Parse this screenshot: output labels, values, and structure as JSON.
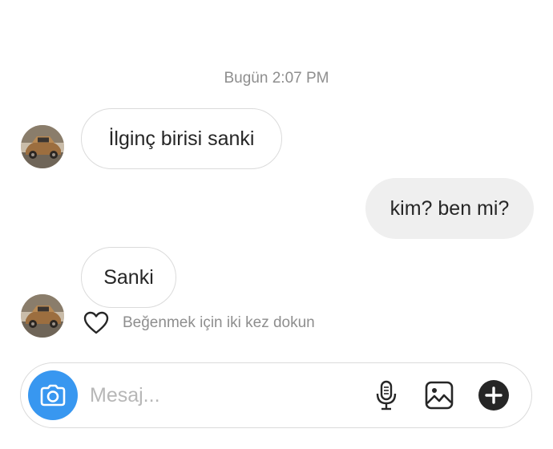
{
  "thread": {
    "timestamp": "Bugün 2:07 PM",
    "messages": [
      {
        "direction": "incoming",
        "text": "İlginç birisi sanki"
      },
      {
        "direction": "outgoing",
        "text": "kim? ben mi?"
      },
      {
        "direction": "incoming",
        "text": "Sanki"
      }
    ],
    "like_hint": "Beğenmek için iki kez dokun"
  },
  "composer": {
    "placeholder": "Mesaj...",
    "value": "",
    "icons": {
      "camera": "camera-icon",
      "microphone": "microphone-icon",
      "gallery": "image-gallery-icon",
      "more": "plus-circle-icon",
      "like": "heart-icon"
    }
  },
  "colors": {
    "accent": "#3897f0",
    "outgoing_bubble": "#efefef",
    "incoming_border": "#dbdbdb",
    "text": "#262626",
    "secondary_text": "#8e8e8e"
  }
}
